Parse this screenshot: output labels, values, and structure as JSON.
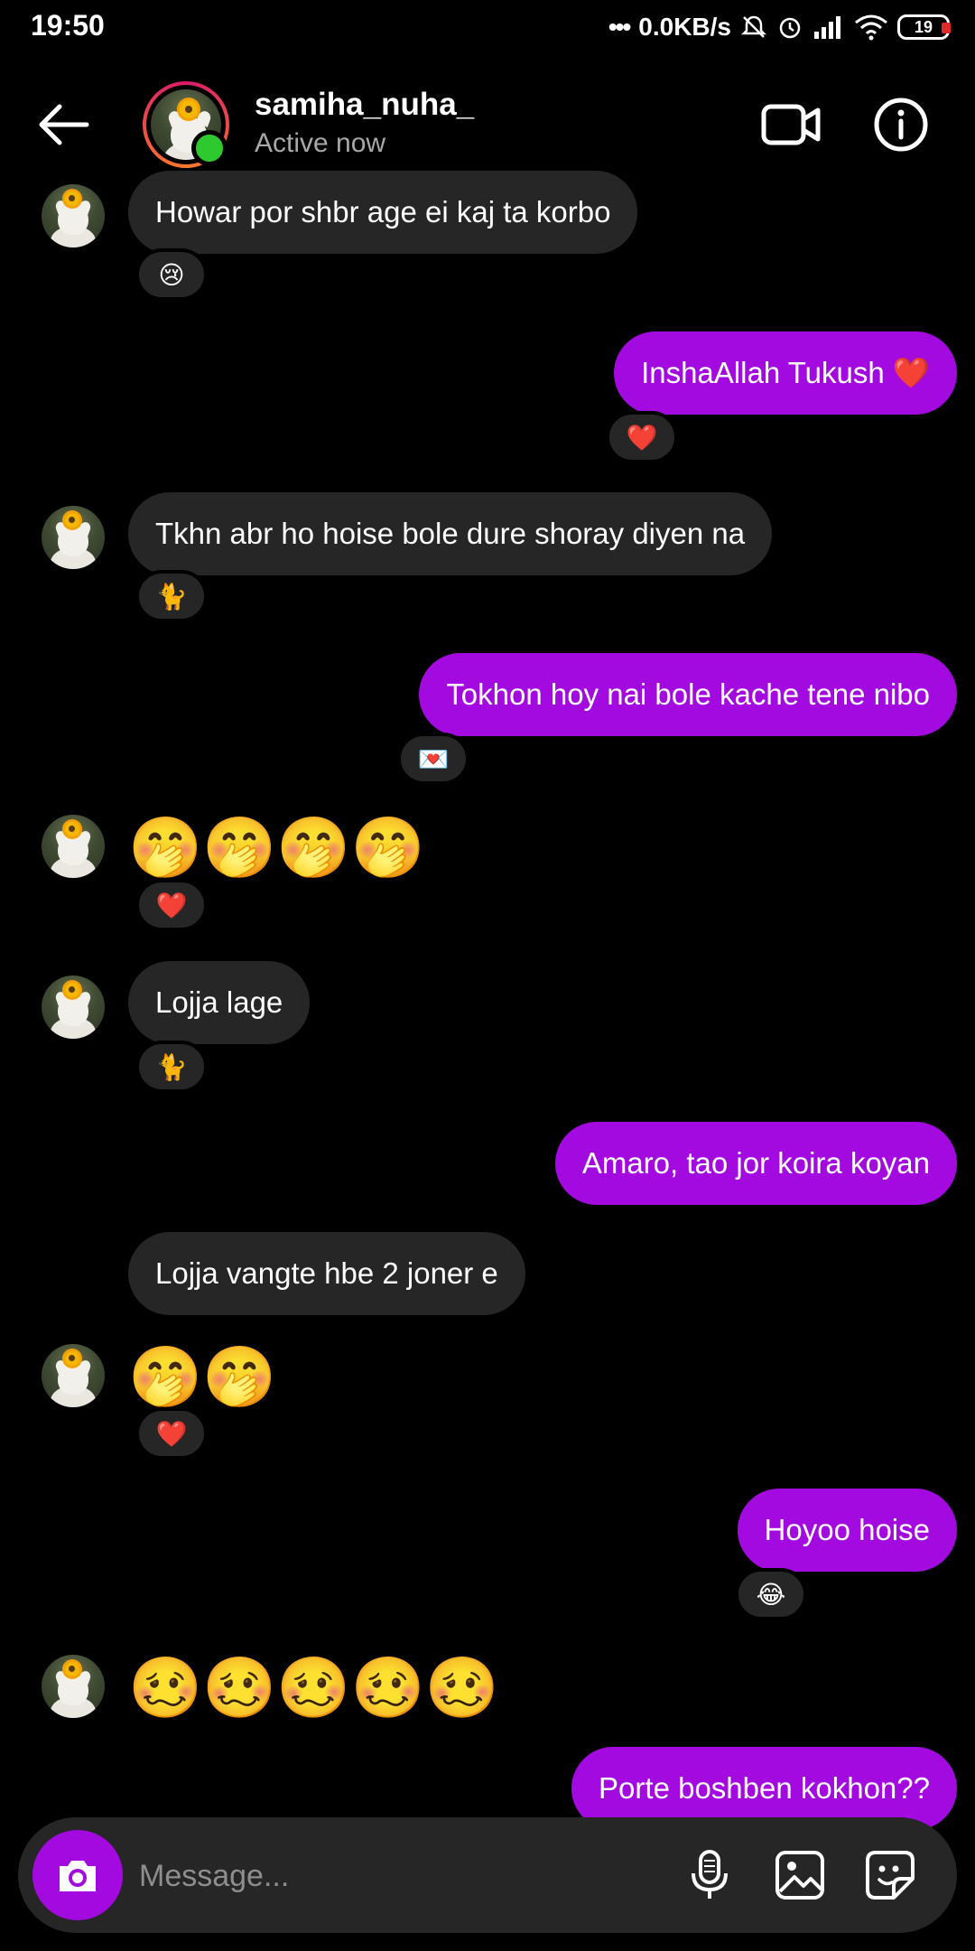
{
  "status_bar": {
    "time": "19:50",
    "net_speed": "0.0KB/s",
    "battery": "19",
    "icons": [
      "dots-icon",
      "mute-icon",
      "alarm-icon",
      "signal-icon",
      "wifi-icon",
      "battery-icon"
    ]
  },
  "header": {
    "username": "samiha_nuha_",
    "status": "Active now",
    "icons": [
      "back-arrow-icon",
      "video-call-icon",
      "info-icon"
    ]
  },
  "messages": [
    {
      "dir": "in",
      "text": "Howar por shbr age ei kaj ta korbo",
      "reaction": "😢"
    },
    {
      "dir": "out",
      "text": "InshaAllah Tukush ❤️",
      "reaction": "❤️"
    },
    {
      "dir": "in",
      "text": "Tkhn abr ho hoise bole dure shoray diyen na",
      "reaction": "🐈"
    },
    {
      "dir": "out",
      "text": "Tokhon hoy nai bole kache tene nibo",
      "reaction": "💌"
    },
    {
      "dir": "in",
      "text": "🤭🤭🤭🤭",
      "reaction": "❤️"
    },
    {
      "dir": "in",
      "text": "Lojja lage",
      "reaction": "🐈"
    },
    {
      "dir": "out",
      "text": "Amaro, tao jor koira koyan",
      "reaction": ""
    },
    {
      "dir": "in",
      "text": "Lojja vangte hbe 2 joner e",
      "reaction": ""
    },
    {
      "dir": "in",
      "text": "🤭🤭",
      "reaction": "❤️"
    },
    {
      "dir": "out",
      "text": "Hoyoo hoise",
      "reaction": "😂"
    },
    {
      "dir": "in",
      "text": "🥴🥴🥴🥴🥴",
      "reaction": ""
    },
    {
      "dir": "out",
      "text": "Porte boshben kokhon??",
      "reaction": ""
    }
  ],
  "composer": {
    "placeholder": "Message...",
    "icons": [
      "camera-icon",
      "microphone-icon",
      "gallery-icon",
      "sticker-icon"
    ]
  },
  "colors": {
    "background": "#000000",
    "incoming_bubble": "#262626",
    "outgoing_bubble": "#a30ae0",
    "online": "#2ec92e"
  }
}
